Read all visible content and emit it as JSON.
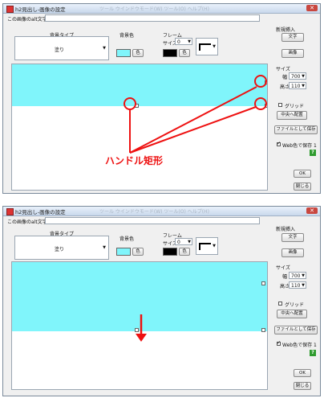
{
  "dialog": {
    "title": "h2見出し-画像の設定",
    "menu_ghost": "ツール  ウインドウモード(W)  ツール(O)  ヘルプ(H)",
    "alt_label": "この画像のalt文字",
    "alt_value": "",
    "bg_type_label": "背景タイプ",
    "bg_type_value": "塗り",
    "bg_color_label": "背景色",
    "color_button": "色",
    "frame_label": "フレーム",
    "frame_size_label": "サイズ",
    "frame_size_value": "0",
    "new_insert_label": "新規挿入",
    "text_button": "文字",
    "image_button": "画像",
    "size_label": "サイズ",
    "width_label": "幅",
    "width_value": "700",
    "height_label": "高さ",
    "height_value": "110",
    "grid_label": "グリッド",
    "center_button": "中央へ配置",
    "save_file_button": "ファイルとして保存",
    "web_color_label": "Web色で保存 1",
    "ok_button": "OK",
    "close_button": "閉じる"
  },
  "panel2": {
    "height_value": "110"
  },
  "annotation": {
    "text": "ハンドル矩形"
  },
  "colors": {
    "bg_color": "#80f5fb",
    "frame_color": "#000000",
    "annotation": "#e11111"
  }
}
